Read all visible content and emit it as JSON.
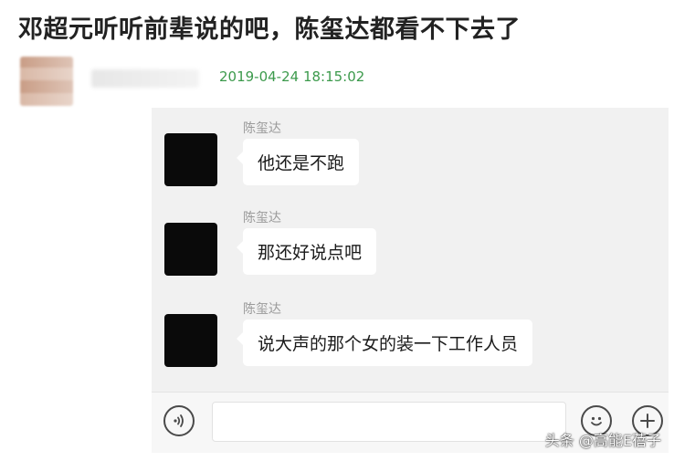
{
  "headline": "邓超元听听前辈说的吧，陈玺达都看不下去了",
  "post": {
    "timestamp": "2019-04-24 18:15:02"
  },
  "messages": [
    {
      "sender": "陈玺达",
      "text": "他还是不跑"
    },
    {
      "sender": "陈玺达",
      "text": "那还好说点吧"
    },
    {
      "sender": "陈玺达",
      "text": "说大声的那个女的装一下工作人员"
    }
  ],
  "input_bar": {
    "voice_icon": "voice-icon",
    "emoji_icon": "emoji-icon",
    "plus_icon": "plus-icon"
  },
  "watermark": "头条 @高能E蓓子",
  "colors": {
    "timestamp": "#3c9a4c",
    "chat_background": "#f1f1f1",
    "bubble": "#ffffff",
    "avatar": "#0a0a0a"
  }
}
